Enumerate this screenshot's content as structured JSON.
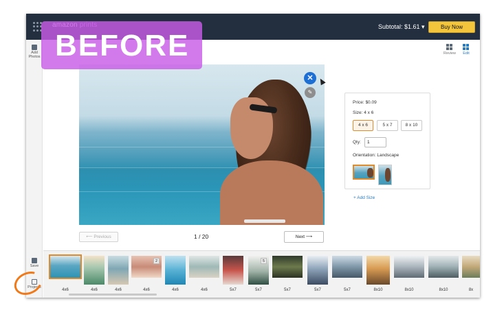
{
  "header": {
    "brand_part1": "amazon",
    "brand_part2": "prints",
    "subtotal": "Subtotal: $1.61 ▾",
    "buy_now": "Buy Now"
  },
  "sidebar": {
    "add_photos": "Add Photos",
    "save": "Save",
    "projects": "Projects"
  },
  "view_switch": {
    "review": "Review",
    "edit": "Edit"
  },
  "product": {
    "price_label": "Price:",
    "price_value": "$0.09",
    "size_label": "Size:",
    "size_value": "4 x 6",
    "sizes": [
      "4 x 6",
      "5 x 7",
      "8 x 10"
    ],
    "selected_size": "4 x 6",
    "qty_label": "Qty:",
    "qty_value": "1",
    "orientation_label": "Orientation:",
    "orientation_value": "Landscape",
    "add_size": "+ Add Size"
  },
  "navigation": {
    "previous": "⟵ Previous",
    "page": "1 / 20",
    "next": "Next ⟶"
  },
  "thumbnails": [
    {
      "caption": "4x6",
      "badge": ""
    },
    {
      "caption": "4x6",
      "badge": ""
    },
    {
      "caption": "4x6",
      "badge": ""
    },
    {
      "caption": "4x6",
      "badge": "2"
    },
    {
      "caption": "4x6",
      "badge": ""
    },
    {
      "caption": "4x6",
      "badge": ""
    },
    {
      "caption": "5x7",
      "badge": ""
    },
    {
      "caption": "5x7",
      "badge": "5"
    },
    {
      "caption": "5x7",
      "badge": ""
    },
    {
      "caption": "5x7",
      "badge": ""
    },
    {
      "caption": "5x7",
      "badge": ""
    },
    {
      "caption": "8x10",
      "badge": ""
    },
    {
      "caption": "8x10",
      "badge": ""
    },
    {
      "caption": "8x10",
      "badge": ""
    },
    {
      "caption": "8x",
      "badge": ""
    }
  ],
  "overlay": {
    "label": "BEFORE"
  },
  "colors": {
    "topbar": "#232f3e",
    "buy_button": "#f2c53c",
    "selection": "#e08a2c",
    "link": "#2a7ac0",
    "overlay": "#c85ce6",
    "annotation": "#f07a1a"
  },
  "icons": {
    "apps": "grid-icon",
    "add_photos": "add-photos-icon",
    "review": "review-grid-icon",
    "edit": "edit-view-icon",
    "remove": "close-icon",
    "edit_photo": "pencil-icon",
    "save": "save-icon",
    "projects": "projects-icon"
  }
}
